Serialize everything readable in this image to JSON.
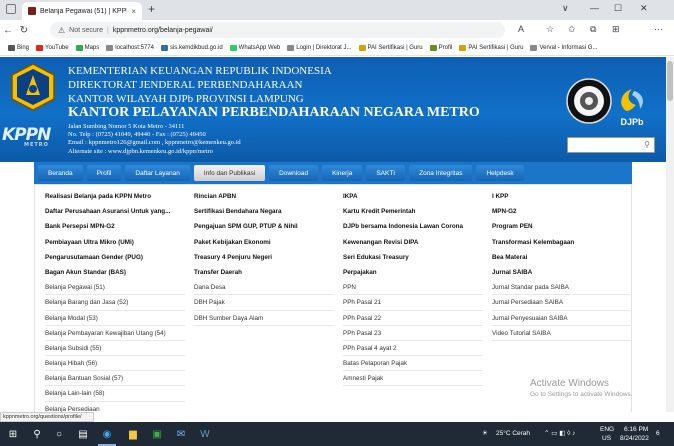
{
  "browser": {
    "tab_title": "Belanja Pegawai (51) | KPPN Metr",
    "tab_close": "×",
    "new_tab": "+",
    "window_controls": [
      "∨",
      "—",
      "☐",
      "✕"
    ],
    "not_secure": "Not secure",
    "separator": "|",
    "url": "kppnmetro.org/belanja-pegawai/",
    "bookmarks": [
      {
        "label": "Bing",
        "color": "#555"
      },
      {
        "label": "YouTube",
        "color": "#e62117"
      },
      {
        "label": "Maps",
        "color": "#34a853"
      },
      {
        "label": "localhost:5774",
        "color": "#888"
      },
      {
        "label": "sis.kemdikbud.go.id",
        "color": "#2a6db4"
      },
      {
        "label": "WhatsApp Web",
        "color": "#25d366"
      },
      {
        "label": "Login | Direktorat J...",
        "color": "#888"
      },
      {
        "label": "PAI Sertifikasi | Guru",
        "color": "#d4a20a"
      },
      {
        "label": "Profil",
        "color": "#6b8e23"
      },
      {
        "label": "PAI Sertifikasi | Guru",
        "color": "#d4a20a"
      },
      {
        "label": "Verval - Informasi G...",
        "color": "#888"
      }
    ]
  },
  "header": {
    "line1": "KEMENTERIAN KEUANGAN REPUBLIK INDONESIA",
    "line2": "DIREKTORAT JENDERAL PERBENDAHARAAN",
    "line3": "KANTOR WILAYAH DJPb PROVINSI LAMPUNG",
    "line4": "KANTOR PELAYANAN PERBENDAHARAAN NEGARA METRO",
    "address": "Jalan Sumbing Nomor 5 Kota Metro - 34111",
    "phone": "No. Telp : (0725) 41049, 49440 - Fax : (0725) 49450",
    "email": "Email : kppnmetro126@gmail.com , kppnmetro@kemenkeu.go.id",
    "website": "Alternate site : www.djpbn.kemenkeu.go.id/kppn/metro",
    "kppn_logo": "KPPN",
    "kppn_logo_sub": "METRO",
    "djpb_logo": "DJPb",
    "search_icon": "⚲"
  },
  "nav": {
    "items": [
      "Beranda",
      "Profil",
      "Daftar Layanan",
      "Info dan Publikasi",
      "Download",
      "Kinerja",
      "SAKTI",
      "Zona Integritas",
      "Helpdesk"
    ],
    "active_index": 3
  },
  "menu": {
    "col1": [
      "Realisasi Belanja pada KPPN Metro",
      "Daftar Perusahaan Asuransi Untuk yang...",
      "Bank Persepsi MPN-G2",
      "Pembiayaan Ultra Mikro (UMi)",
      "Pengarusutamaan Gender (PUG)",
      "Bagan Akun Standar (BAS)",
      "Belanja Pegawai (51)",
      "Belanja Barang dan Jasa (52)",
      "Belanja Modal (53)",
      "Belanja Pembayaran Kewajiban Utang (54)",
      "Belanja Subsidi (55)",
      "Belanja Hibah (56)",
      "Belanja Bantuan Sosial (57)",
      "Belanja Lain-lain (58)",
      "Belanja Persediaan"
    ],
    "col2": [
      "Rincian APBN",
      "Sertifikasi Bendahara Negara",
      "Pengajuan SPM GUP, PTUP & Nihil",
      "Paket Kebijakan Ekonomi",
      "Treasury 4 Penjuru Negeri",
      "Transfer Daerah",
      "Dana Desa",
      "DBH Pajak",
      "DBH Sumber Daya Alam"
    ],
    "col3": [
      "IKPA",
      "Kartu Kredit Pemerintah",
      "DJPb bersama Indonesia Lawan Corona",
      "Kewenangan Revisi DIPA",
      "Seri Edukasi Treasury",
      "Perpajakan",
      "PPN",
      "PPh Pasal 21",
      "PPh Pasal 22",
      "PPh Pasal 23",
      "PPh Pasal 4 ayat 2",
      "Batas Pelaporan Pajak",
      "Amnesti Pajak"
    ],
    "col4": [
      "I KPP",
      "MPN-G2",
      "Program PEN",
      "Transformasi Kelembagaan",
      "Bea Materai",
      "Jurnal SAIBA",
      "Jurnal Standar pada SAIBA",
      "Jurnal Persediaan SAIBA",
      "Jurnal Penyesuaian SAIBA",
      "Video Tutorial SAIBA"
    ]
  },
  "status_url": "kppnmetro.org/questions/profile/",
  "activate": {
    "title": "Activate Windows",
    "subtitle": "Go to Settings to activate Windows."
  },
  "taskbar": {
    "weather": "25°C  Cerah",
    "lang": "ENG",
    "region": "US",
    "time": "6:16 PM",
    "date": "8/24/2022",
    "notifications": "6"
  }
}
